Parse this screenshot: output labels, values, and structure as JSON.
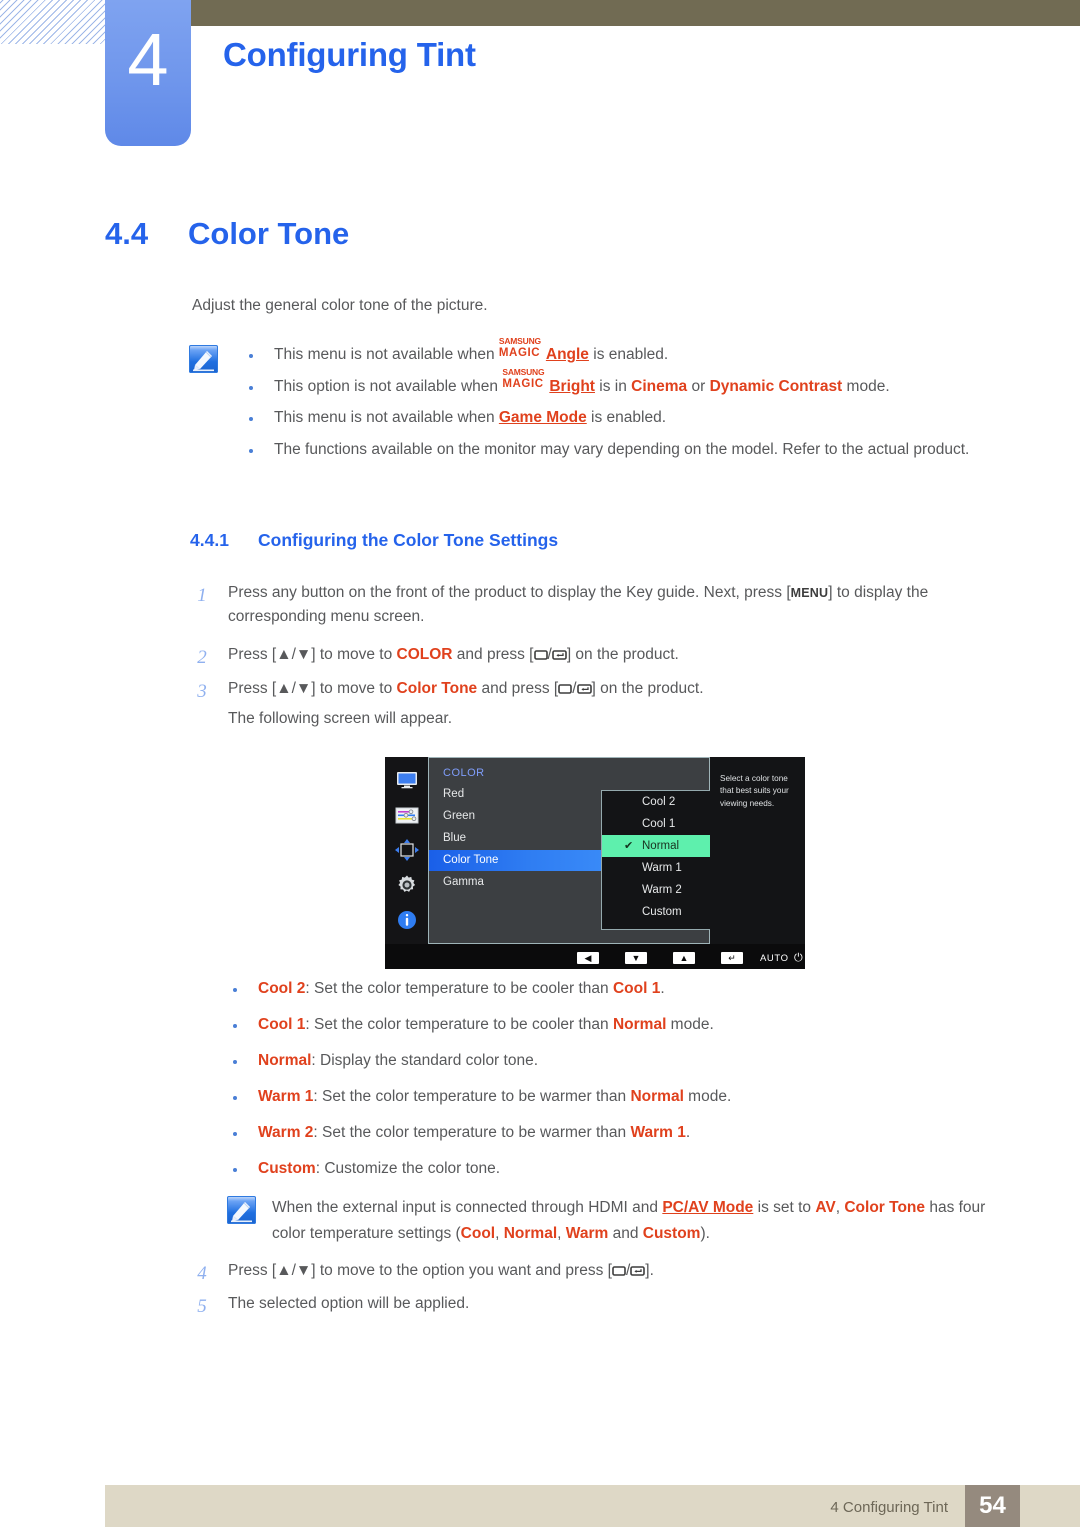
{
  "header": {
    "chapter_number": "4",
    "chapter_title": "Configuring Tint"
  },
  "section": {
    "number": "4.4",
    "title": "Color Tone",
    "intro": "Adjust the general color tone of the picture."
  },
  "note_one": {
    "icon": "note-pen-icon",
    "bullets": [
      {
        "pre": "This menu is not available when ",
        "magic_small": "SAMSUNG",
        "magic_big": "MAGIC",
        "magic_word": "Angle",
        "post": " is enabled."
      },
      {
        "pre": "This option is not available when ",
        "magic_small": "SAMSUNG",
        "magic_big": "MAGIC",
        "magic_word": "Bright",
        "mid": " is in ",
        "term1": "Cinema",
        "conj": " or ",
        "term2": "Dynamic Contrast",
        "post": " mode."
      },
      {
        "pre": "This menu is not available when ",
        "term1": "Game Mode",
        "post": " is enabled."
      },
      {
        "pre": "The functions available on the monitor may vary depending on the model. Refer to the actual product."
      }
    ]
  },
  "subsection": {
    "number": "4.4.1",
    "title": "Configuring the Color Tone Settings"
  },
  "steps": {
    "step1": {
      "number": "1",
      "part1": "Press any button on the front of the product to display the Key guide. Next, press [",
      "key": "MENU",
      "part2": "] to display the corresponding menu screen."
    },
    "step2": {
      "number": "2",
      "part1": "Press [",
      "arrows": "▲/▼",
      "part2": "] to move to ",
      "target": "COLOR",
      "part3": " and press [",
      "part4": "] on the product."
    },
    "step3": {
      "number": "3",
      "part1": "Press [",
      "arrows": "▲/▼",
      "part2": "] to move to ",
      "target": "Color Tone",
      "part3": " and press [",
      "part4": "] on the product.",
      "followup": "The following screen will appear."
    },
    "step4": {
      "number": "4",
      "part1": "Press [",
      "arrows": "▲/▼",
      "part2": "] to move to the option you want and press [",
      "part3": "]."
    },
    "step5": {
      "number": "5",
      "text": "The selected option will be applied."
    }
  },
  "osd": {
    "rail_icons": [
      "monitor-icon",
      "sliders-icon",
      "four-way-arrows-icon",
      "gear-icon",
      "info-icon"
    ],
    "category": "COLOR",
    "menu_items": [
      {
        "label": "Red",
        "selected": false
      },
      {
        "label": "Green",
        "selected": false
      },
      {
        "label": "Blue",
        "selected": false
      },
      {
        "label": "Color Tone",
        "selected": true
      },
      {
        "label": "Gamma",
        "selected": false
      }
    ],
    "options": [
      {
        "label": "Cool 2",
        "checked": false
      },
      {
        "label": "Cool 1",
        "checked": false
      },
      {
        "label": "Normal",
        "checked": true
      },
      {
        "label": "Warm 1",
        "checked": false
      },
      {
        "label": "Warm 2",
        "checked": false
      },
      {
        "label": "Custom",
        "checked": false
      }
    ],
    "help_text": "Select a color tone that best suits your viewing needs.",
    "bottom_buttons": [
      "left-arrow-icon",
      "down-arrow-icon",
      "up-arrow-icon",
      "enter-icon",
      "AUTO",
      "power-icon"
    ],
    "auto_label": "AUTO"
  },
  "option_descriptions": [
    {
      "term": "Cool 2",
      "mid": ": Set the color temperature to be cooler than ",
      "ref": "Cool 1",
      "end": "."
    },
    {
      "term": "Cool 1",
      "mid": ": Set the color temperature to be cooler than ",
      "ref": "Normal",
      "end": " mode."
    },
    {
      "term": "Normal",
      "mid": ": Display the standard color tone.",
      "ref": "",
      "end": ""
    },
    {
      "term": "Warm 1",
      "mid": ": Set the color temperature to be warmer than ",
      "ref": "Normal",
      "end": " mode."
    },
    {
      "term": "Warm 2",
      "mid": ": Set the color temperature to be warmer than ",
      "ref": "Warm 1",
      "end": "."
    },
    {
      "term": "Custom",
      "mid": ": Customize the color tone.",
      "ref": "",
      "end": ""
    }
  ],
  "note_two": {
    "icon": "note-pen-icon",
    "p1": "When the external input is connected through HDMI and ",
    "link": "PC/AV Mode",
    "p2": " is set to ",
    "av": "AV",
    "p3": ", ",
    "color_tone": "Color Tone",
    "p4": " has four color temperature settings (",
    "o1": "Cool",
    "s1": ", ",
    "o2": "Normal",
    "s2": ", ",
    "o3": "Warm",
    "s3": " and ",
    "o4": "Custom",
    "p5": ")."
  },
  "footer": {
    "text": "4 Configuring Tint",
    "page": "54"
  },
  "colors": {
    "accent_blue": "#2563eb",
    "term_red": "#e0411d",
    "footer_bar": "#ded8c6",
    "page_box": "#958a7e",
    "topbar": "#716b53",
    "osd_highlight": "#5ef0ad"
  }
}
